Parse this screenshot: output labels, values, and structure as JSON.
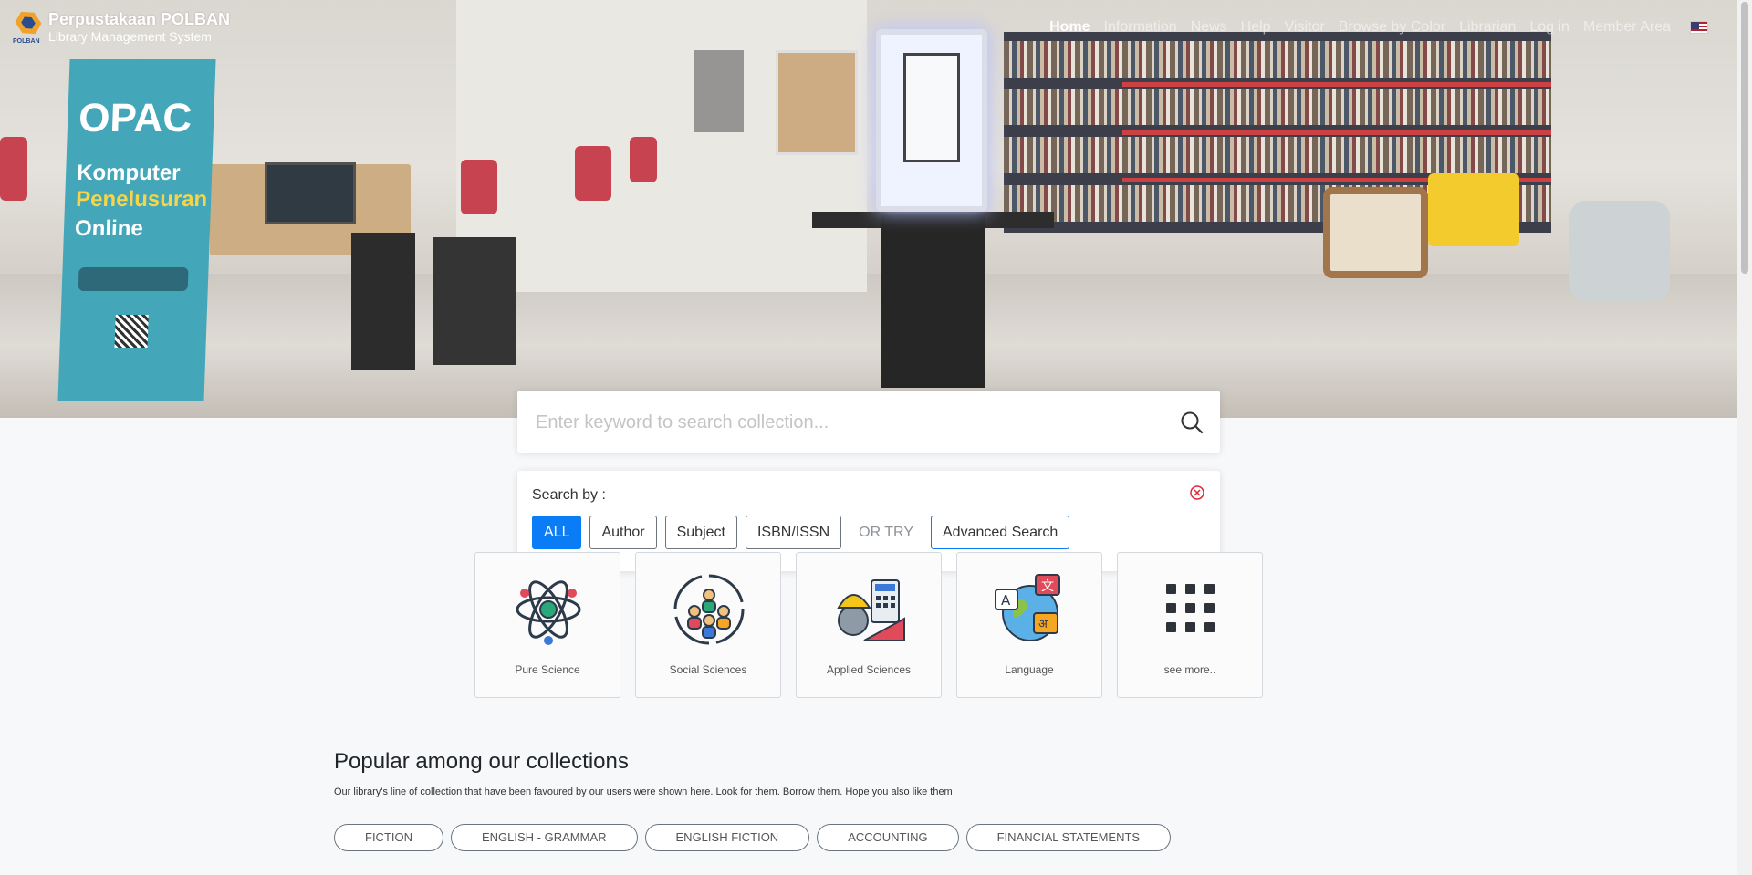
{
  "brand": {
    "title": "Perpustakaan POLBAN",
    "subtitle": "Library Management System",
    "logo_text": "POLBAN"
  },
  "nav": {
    "items": [
      {
        "label": "Home",
        "active": true
      },
      {
        "label": "Information"
      },
      {
        "label": "News"
      },
      {
        "label": "Help"
      },
      {
        "label": "Visitor"
      },
      {
        "label": "Browse by Color"
      },
      {
        "label": "Librarian"
      },
      {
        "label": "Log in"
      },
      {
        "label": "Member Area"
      }
    ],
    "language_icon": "us-flag-icon"
  },
  "search": {
    "placeholder": "Enter keyword to search collection...",
    "search_by_label": "Search by :",
    "buttons": [
      {
        "label": "ALL",
        "active": true
      },
      {
        "label": "Author"
      },
      {
        "label": "Subject"
      },
      {
        "label": "ISBN/ISSN"
      }
    ],
    "or_try": "OR TRY",
    "advanced": "Advanced Search"
  },
  "categories": [
    {
      "label": "Pure Science",
      "icon": "atom-icon"
    },
    {
      "label": "Social Sciences",
      "icon": "people-icon"
    },
    {
      "label": "Applied Sciences",
      "icon": "engineer-icon"
    },
    {
      "label": "Language",
      "icon": "globe-language-icon"
    },
    {
      "label": "see more..",
      "icon": "grid-icon"
    }
  ],
  "popular": {
    "title": "Popular among our collections",
    "subtitle": "Our library's line of collection that have been favoured by our users were shown here. Look for them. Borrow them. Hope you also like them",
    "tags": [
      "FICTION",
      "ENGLISH - GRAMMAR",
      "ENGLISH FICTION",
      "ACCOUNTING",
      "FINANCIAL STATEMENTS"
    ]
  },
  "hero_banner": {
    "opac": "OPAC",
    "line1": "Komputer",
    "line2": "Penelusuran",
    "line3": "Online"
  },
  "colors": {
    "primary": "#0a7cf5",
    "background": "#f7f8fa"
  }
}
